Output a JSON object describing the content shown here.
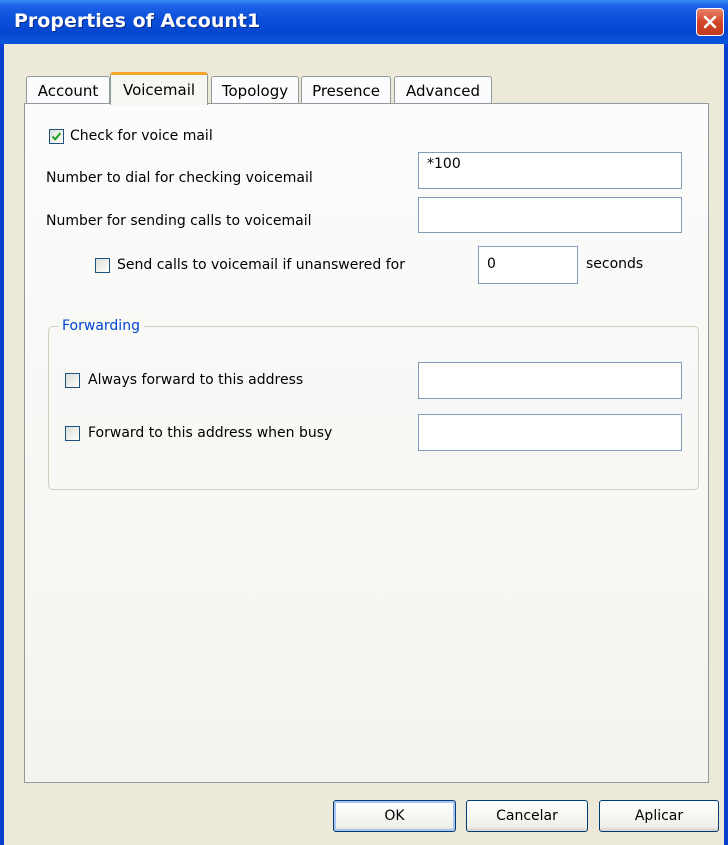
{
  "window": {
    "title": "Properties of Account1"
  },
  "tabs": [
    {
      "label": "Account"
    },
    {
      "label": "Voicemail"
    },
    {
      "label": "Topology"
    },
    {
      "label": "Presence"
    },
    {
      "label": "Advanced"
    }
  ],
  "voicemail": {
    "check_voicemail": {
      "label": "Check for voice mail",
      "checked": true
    },
    "dial_number": {
      "label": "Number to dial for checking voicemail",
      "value": "*100"
    },
    "sending_number": {
      "label": "Number for sending calls to voicemail",
      "value": ""
    },
    "unanswered": {
      "label": "Send calls to voicemail if unanswered for",
      "checked": false,
      "value": "0",
      "unit": "seconds"
    }
  },
  "forwarding": {
    "title": "Forwarding",
    "always": {
      "label": "Always forward to this address",
      "checked": false,
      "value": ""
    },
    "busy": {
      "label": "Forward to this address when busy",
      "checked": false,
      "value": ""
    }
  },
  "buttons": {
    "ok": "OK",
    "cancel": "Cancelar",
    "apply": "Aplicar"
  },
  "colors": {
    "titlebar": "#0a4fd9",
    "legend": "#0046d5",
    "checkmark": "#21a121"
  }
}
